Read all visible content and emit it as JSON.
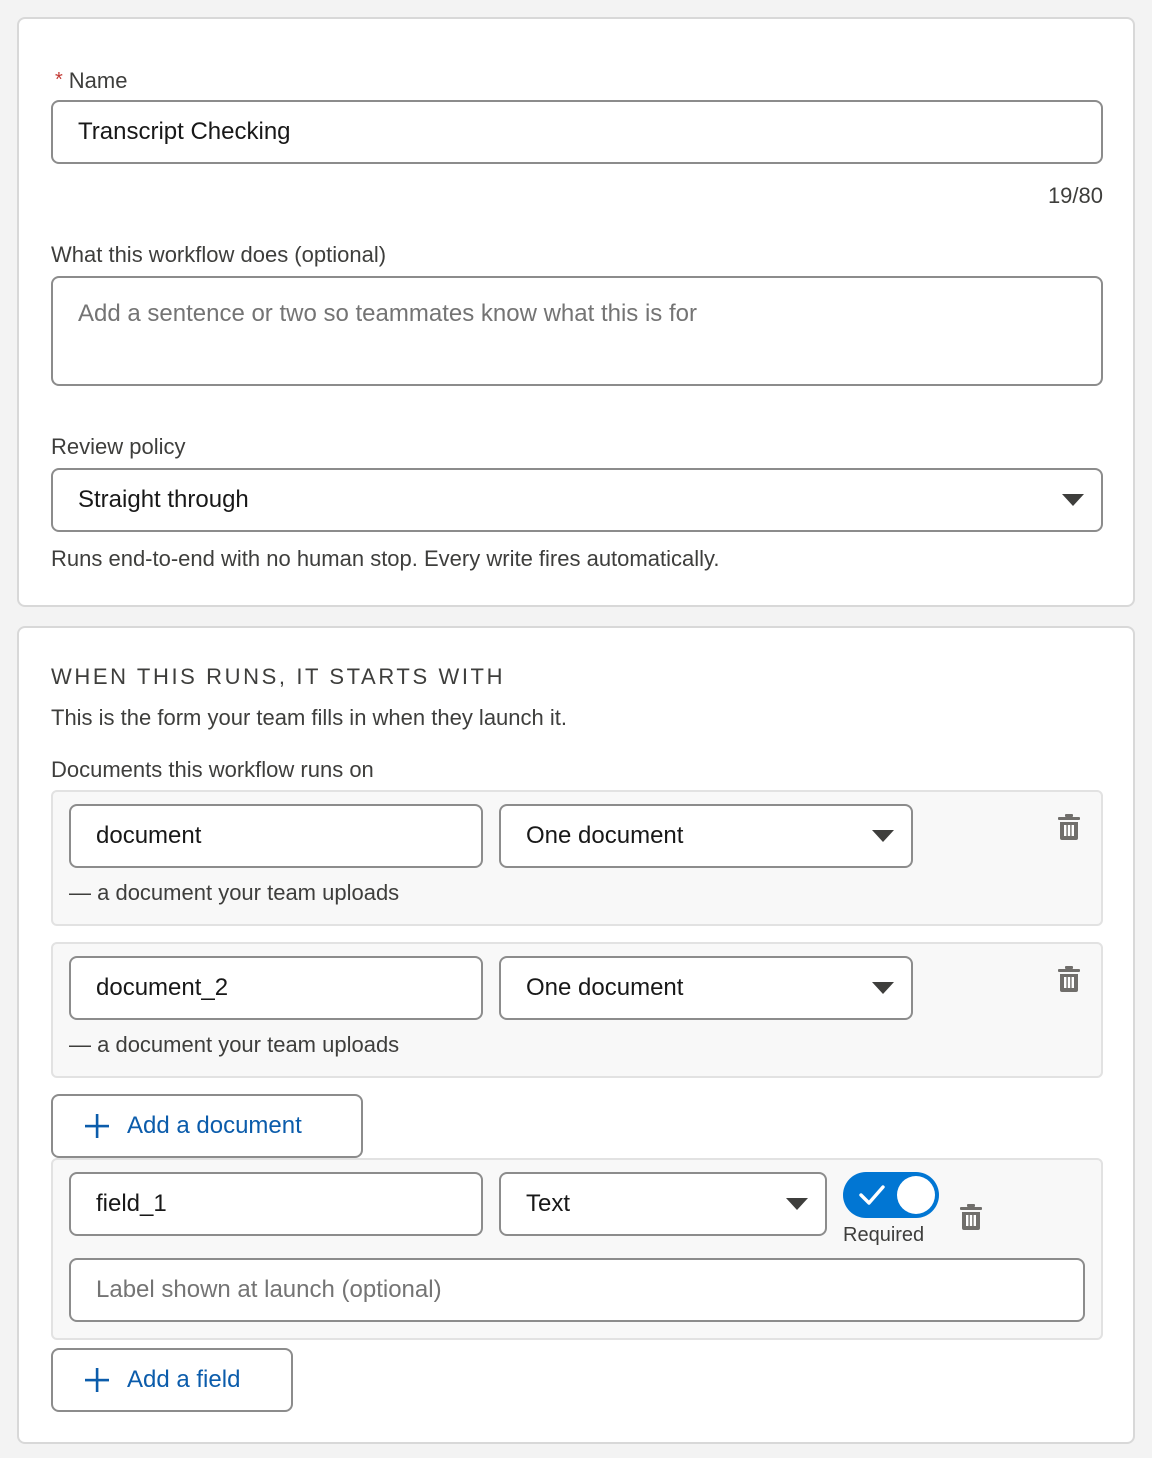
{
  "details": {
    "name_label": "Name",
    "name_required_marker": "*",
    "name_value": "Transcript Checking",
    "name_counter": "19/80",
    "description_label": "What this workflow does (optional)",
    "description_placeholder": "Add a sentence or two so teammates know what this is for",
    "review_policy_label": "Review policy",
    "review_policy_value": "Straight through",
    "review_policy_hint": "Runs end-to-end with no human stop. Every write fires automatically."
  },
  "start": {
    "section_title": "WHEN THIS RUNS, IT STARTS WITH",
    "section_subtitle": "This is the form your team fills in when they launch it.",
    "documents_label": "Documents this workflow runs on",
    "documents": [
      {
        "name": "document",
        "type": "One document",
        "hint": "— a document your team uploads"
      },
      {
        "name": "document_2",
        "type": "One document",
        "hint": "— a document your team uploads"
      }
    ],
    "add_document_label": "Add a document",
    "fields": [
      {
        "name": "field_1",
        "type": "Text",
        "required_label": "Required",
        "required": true,
        "label_placeholder": "Label shown at launch (optional)"
      }
    ],
    "add_field_label": "Add a field"
  },
  "icons": {
    "trash": "trash-icon",
    "dropdown": "chevron-down-icon",
    "plus": "plus-icon",
    "check": "check-icon"
  },
  "colors": {
    "accent": "#0176d3",
    "link": "#0b5cab",
    "required": "#c23934"
  }
}
